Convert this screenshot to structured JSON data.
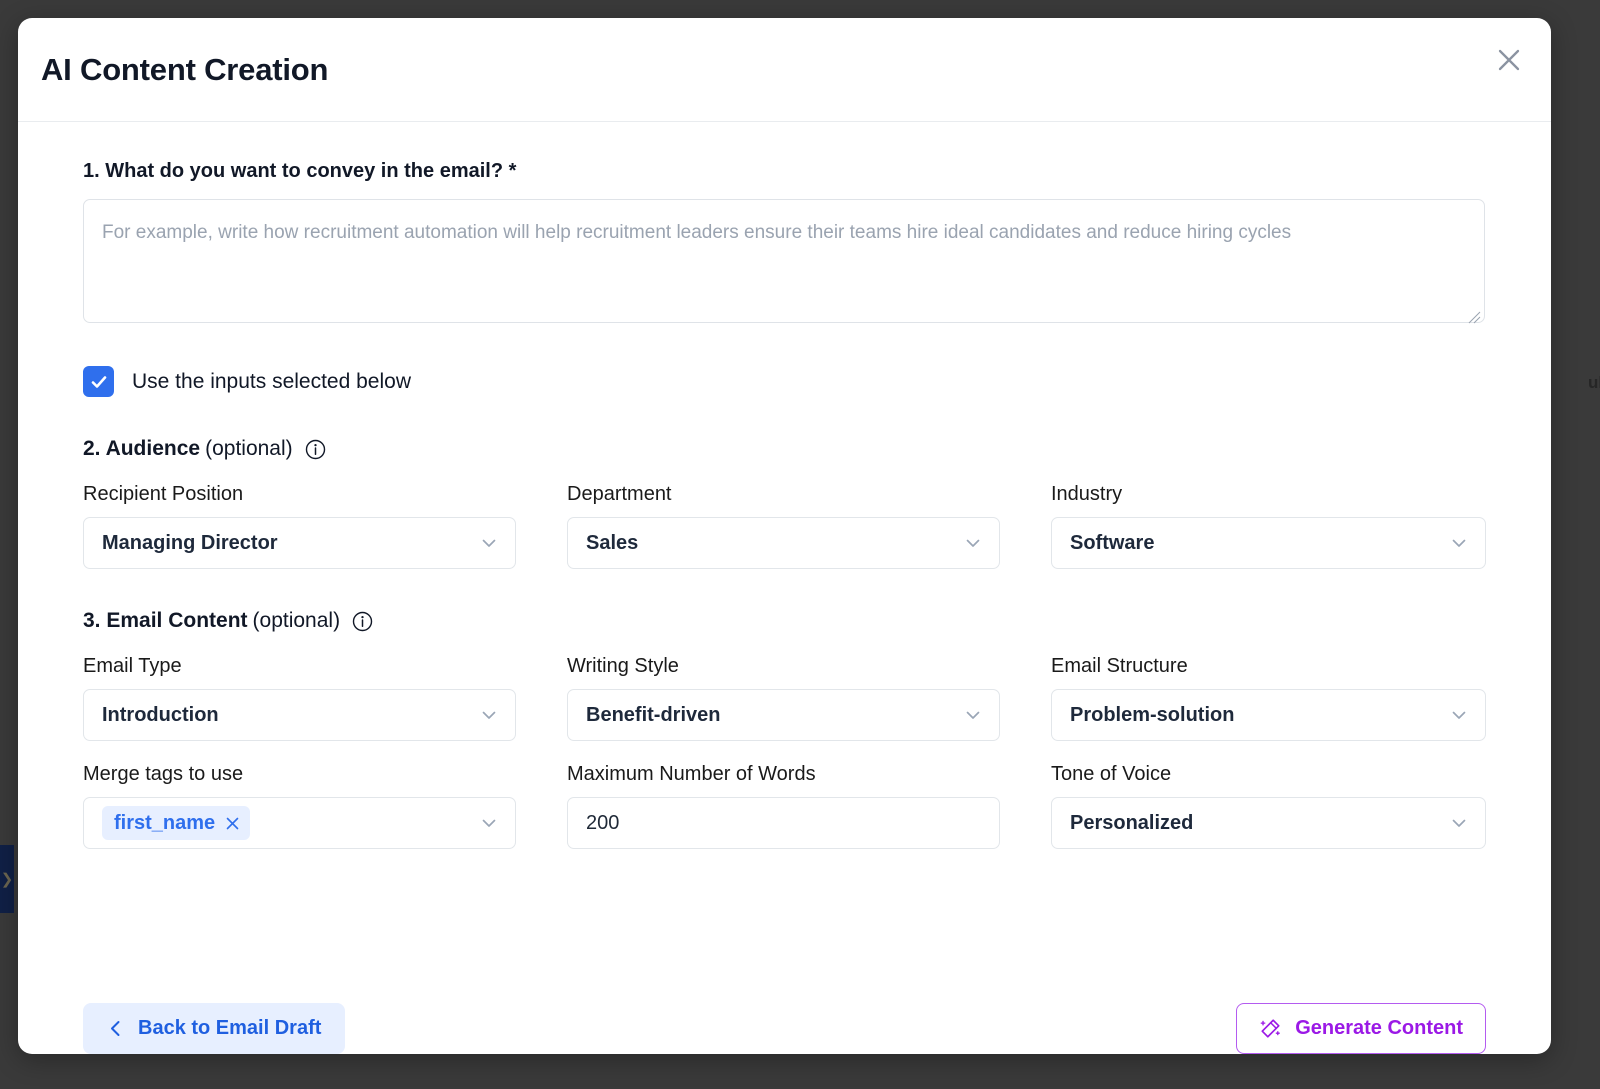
{
  "modal": {
    "title": "AI Content Creation",
    "close_icon": "close-icon"
  },
  "question1": {
    "label": "1. What do you want to convey in the email? *",
    "textarea_value": "",
    "textarea_placeholder": "For example, write how recruitment automation will help recruitment leaders ensure their teams hire ideal candidates and reduce hiring cycles"
  },
  "use_inputs_checkbox": {
    "label": "Use the inputs selected below",
    "checked": true,
    "color": "#2f6fed"
  },
  "audience_section": {
    "number_title": "2. Audience",
    "optional": "(optional)",
    "info_icon": "info-icon",
    "fields": [
      {
        "label": "Recipient Position",
        "value": "Managing Director",
        "type": "select"
      },
      {
        "label": "Department",
        "value": "Sales",
        "type": "select"
      },
      {
        "label": "Industry",
        "value": "Software",
        "type": "select"
      }
    ]
  },
  "email_content_section": {
    "number_title": "3. Email Content",
    "optional": "(optional)",
    "info_icon": "info-icon",
    "fields": [
      {
        "label": "Email Type",
        "value": "Introduction",
        "type": "select"
      },
      {
        "label": "Writing Style",
        "value": "Benefit-driven",
        "type": "select"
      },
      {
        "label": "Email Structure",
        "value": "Problem-solution",
        "type": "select"
      },
      {
        "label": "Merge tags to use",
        "value": "first_name",
        "type": "tag-select"
      },
      {
        "label": "Maximum Number of Words",
        "value": "200",
        "type": "text"
      },
      {
        "label": "Tone of Voice",
        "value": "Personalized",
        "type": "select"
      }
    ]
  },
  "footer": {
    "back_label": "Back to Email Draft",
    "back_icon": "chevron-left-icon",
    "back_color": "#1f5fe0",
    "generate_label": "Generate Content",
    "generate_icon": "magic-wand-icon",
    "generate_color": "#9b19e6"
  },
  "background": {
    "rail_icon": "chevron-right-icon"
  }
}
